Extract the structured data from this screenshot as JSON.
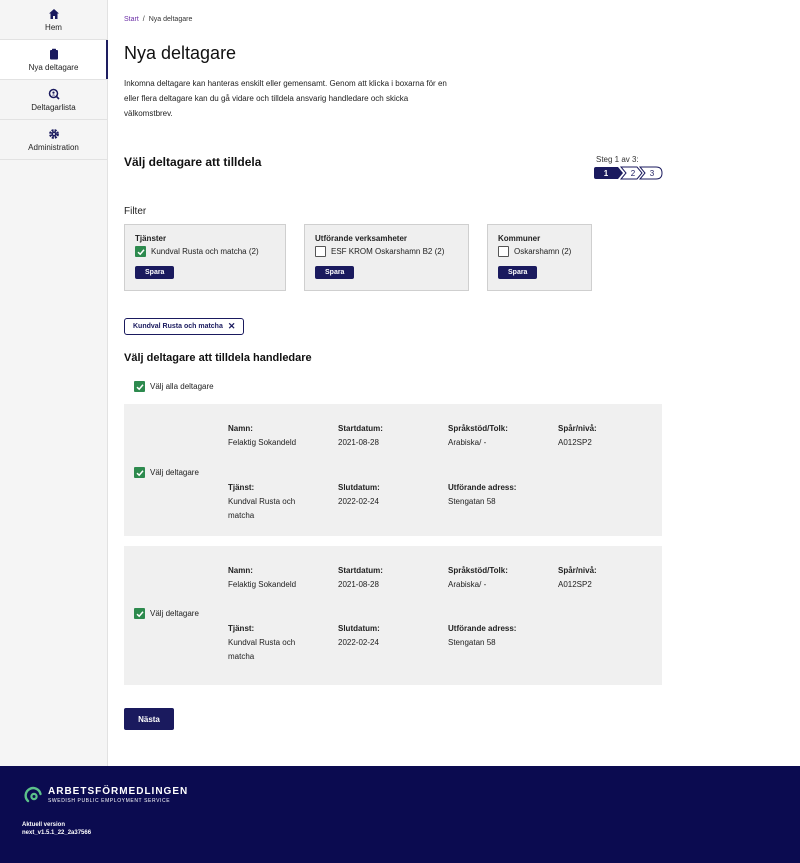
{
  "sidebar": {
    "items": [
      {
        "label": "Hem",
        "icon": "home-icon"
      },
      {
        "label": "Nya deltagare",
        "icon": "clipboard-icon",
        "active": true
      },
      {
        "label": "Deltagarlista",
        "icon": "search-person-icon"
      },
      {
        "label": "Administration",
        "icon": "gear-icon"
      }
    ]
  },
  "breadcrumb": {
    "home": "Start",
    "separator": "/",
    "current": "Nya deltagare"
  },
  "page": {
    "title": "Nya deltagare",
    "intro": "Inkomna deltagare kan hanteras enskilt eller gemensamt. Genom att klicka i boxarna för en eller flera deltagare kan du gå vidare och tilldela ansvarig handledare och skicka välkomstbrev.",
    "section_title": "Välj deltagare att tilldela",
    "step_label": "Steg 1 av 3:",
    "steps": [
      "1",
      "2",
      "3"
    ],
    "current_step": 1
  },
  "filter": {
    "title": "Filter",
    "save_label": "Spara",
    "groups": [
      {
        "title": "Tjänster",
        "option": "Kundval Rusta och matcha (2)",
        "checked": true
      },
      {
        "title": "Utförande verksamheter",
        "option": "ESF KROM Oskarshamn B2 (2)",
        "checked": false
      },
      {
        "title": "Kommuner",
        "option": "Oskarshamn (2)",
        "checked": false
      }
    ],
    "active_chip": "Kundval Rusta och matcha",
    "chip_remove": "✕"
  },
  "participants": {
    "title": "Välj deltagare att tilldela handledare",
    "select_all_label": "Välj alla deltagare",
    "select_label": "Välj deltagare",
    "labels": {
      "name": "Namn:",
      "start": "Startdatum:",
      "language": "Språkstöd/Tolk:",
      "track": "Spår/nivå:",
      "service": "Tjänst:",
      "end": "Slutdatum:",
      "address": "Utförande adress:"
    },
    "rows": [
      {
        "name": "Felaktig Sokandeld",
        "start": "2021-08-28",
        "language": "Arabiska/ -",
        "track": "A012SP2",
        "service": "Kundval Rusta och matcha",
        "end": "2022-02-24",
        "address": "Stengatan 58"
      },
      {
        "name": "Felaktig Sokandeld",
        "start": "2021-08-28",
        "language": "Arabiska/ -",
        "track": "A012SP2",
        "service": "Kundval Rusta och matcha",
        "end": "2022-02-24",
        "address": "Stengatan 58"
      }
    ]
  },
  "next_label": "Nästa",
  "footer": {
    "brand": "ARBETSFÖRMEDLINGEN",
    "brand_sub": "SWEDISH PUBLIC EMPLOYMENT SERVICE",
    "version_label": "Aktuell version",
    "version": "next_v1.5.1_22_2a37566"
  },
  "colors": {
    "primary": "#1a1a5e",
    "checkbox": "#2d8a4e",
    "link": "#6b2ea6",
    "footer_bg": "#0b0b50"
  }
}
